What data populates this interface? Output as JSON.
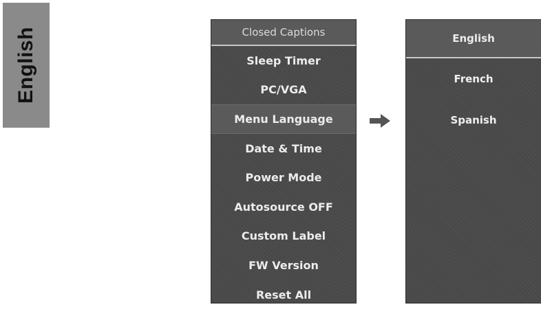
{
  "side_tab": {
    "label": "English"
  },
  "settings_menu": {
    "header": "Closed Captions",
    "items": [
      {
        "label": "Sleep Timer",
        "selected": false
      },
      {
        "label": "PC/VGA",
        "selected": false
      },
      {
        "label": "Menu Language",
        "selected": true
      },
      {
        "label": "Date & Time",
        "selected": false
      },
      {
        "label": "Power Mode",
        "selected": false
      },
      {
        "label": "Autosource OFF",
        "selected": false
      },
      {
        "label": "Custom Label",
        "selected": false
      },
      {
        "label": "FW Version",
        "selected": false
      },
      {
        "label": "Reset All",
        "selected": false
      }
    ]
  },
  "arrow": {
    "icon": "arrow-right-icon",
    "color": "#555555"
  },
  "language_menu": {
    "current": "English",
    "options": [
      "French",
      "Spanish"
    ]
  },
  "colors": {
    "panel_bg": "#4a4a4a",
    "highlight_bg": "#5a5a5a",
    "side_tab_bg": "#8a8a8a"
  }
}
